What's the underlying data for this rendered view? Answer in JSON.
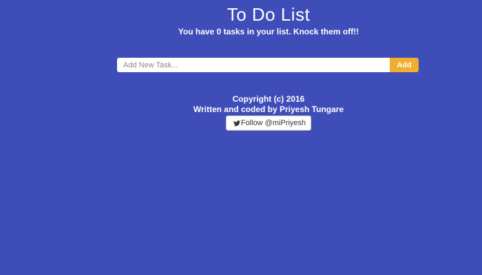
{
  "header": {
    "title": "To Do List",
    "subtitle": "You have 0 tasks in your list. Knock them off!!"
  },
  "task_form": {
    "placeholder": "Add New Task...",
    "value": "",
    "add_label": "Add"
  },
  "footer": {
    "copyright": "Copyright (c) 2016",
    "credit": "Written and coded by Priyesh Tungare",
    "follow_label": "Follow @miPriyesh"
  },
  "icons": {
    "follow": "twitter-bird-icon"
  },
  "colors": {
    "background": "#3f4db9",
    "accent": "#f0ad2e",
    "text": "#ffffff"
  }
}
